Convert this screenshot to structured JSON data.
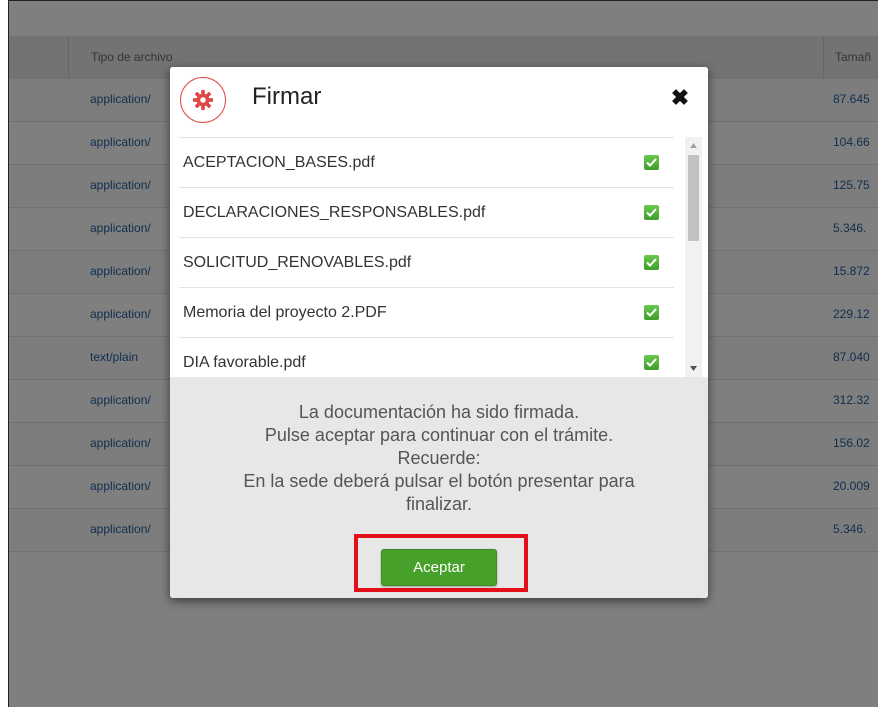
{
  "background_table": {
    "header": {
      "type_col": "Tipo de archivo",
      "size_col": "Tamañ"
    },
    "rows": [
      {
        "type": "application/",
        "size": "87.645"
      },
      {
        "type": "application/",
        "size": "104.66"
      },
      {
        "type": "application/",
        "size": "125.75"
      },
      {
        "type": "application/",
        "size": "5.346."
      },
      {
        "type": "application/",
        "size": "15.872"
      },
      {
        "type": "application/",
        "size": "229.12"
      },
      {
        "type": "text/plain",
        "size": "87.040"
      },
      {
        "type": "application/",
        "size": "312.32"
      },
      {
        "type": "application/",
        "size": "156.02"
      },
      {
        "type": "application/",
        "size": "20.009"
      },
      {
        "type": "application/",
        "size": "5.346."
      }
    ]
  },
  "modal": {
    "title": "Firmar",
    "icon": "gear-icon",
    "close_symbol": "✖",
    "files": [
      {
        "name": "ACEPTACION_BASES.pdf",
        "signed": true
      },
      {
        "name": "DECLARACIONES_RESPONSABLES.pdf",
        "signed": true
      },
      {
        "name": "SOLICITUD_RENOVABLES.pdf",
        "signed": true
      },
      {
        "name": "Memoria del proyecto 2.PDF",
        "signed": true
      },
      {
        "name": "DIA favorable.pdf",
        "signed": true
      }
    ],
    "message_lines": [
      "La documentación ha sido firmada.",
      "Pulse aceptar para continuar con el trámite.",
      "Recuerde:",
      "En la sede deberá pulsar el botón presentar para",
      "finalizar."
    ],
    "accept_label": "Aceptar"
  },
  "colors": {
    "accent_red": "#e04848",
    "highlight_red": "#e3101c",
    "button_green": "#47a02a",
    "link_blue": "#1f5f9e"
  }
}
